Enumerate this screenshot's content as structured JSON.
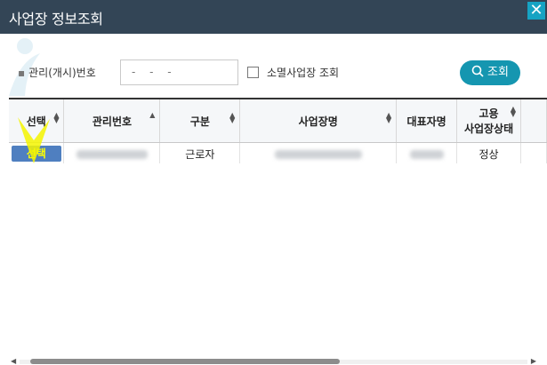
{
  "window": {
    "title": "사업장 정보조회",
    "close_icon": "close-icon"
  },
  "search": {
    "mgmt_no_label": "관리(개시)번호",
    "mgmt_no_value": "- -   -",
    "closed_checkbox_label": "소멸사업장 조회",
    "closed_checked": false,
    "lookup_button": "조회"
  },
  "table": {
    "headers": {
      "select": "선택",
      "mgmt_no": "관리번호",
      "category": "구분",
      "name": "사업장명",
      "rep": "대표자명",
      "status_line1": "고용",
      "status_line2": "사업장상태"
    },
    "rows": [
      {
        "select": "선택",
        "category": "근로자",
        "status": "정상"
      }
    ]
  },
  "colors": {
    "titlebar": "#334556",
    "accent": "#1596b0",
    "select_button": "#4f7fc0",
    "highlight": "#f5f500"
  }
}
